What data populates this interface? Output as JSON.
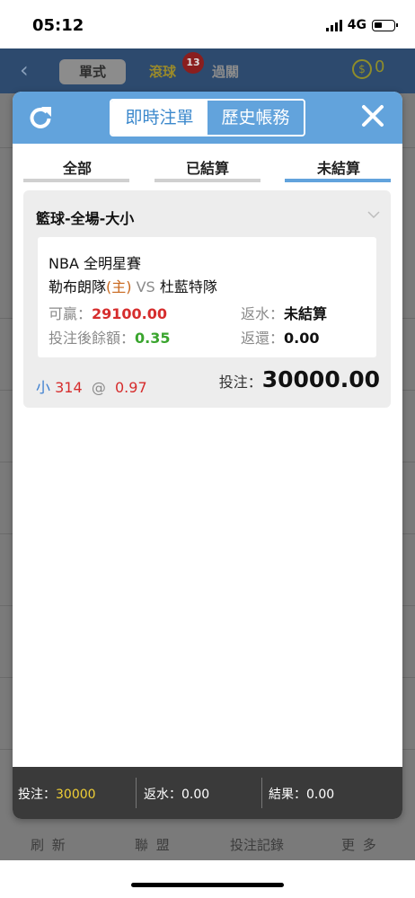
{
  "status_bar": {
    "time": "05:12",
    "network": "4G"
  },
  "background_app": {
    "seg_single": "單式",
    "live": "滾球",
    "live_badge": "13",
    "parlay": "過關",
    "currency_icon": "$",
    "balance": "0",
    "tabbar": [
      "刷 新",
      "聯 盟",
      "投注記錄",
      "更 多"
    ]
  },
  "modal": {
    "header": {
      "tab_instant": "即時注單",
      "tab_history": "歷史帳務"
    },
    "tabs": [
      {
        "label": "全部",
        "active": false
      },
      {
        "label": "已結算",
        "active": false
      },
      {
        "label": "未結算",
        "active": true
      }
    ],
    "bet": {
      "title": "籃球-全場-大小",
      "league": "NBA 全明星賽",
      "home_team": "勒布朗隊",
      "home_tag": "(主)",
      "vs": "VS",
      "away_team": "杜藍特隊",
      "win_label": "可贏：",
      "win_value": "29100.00",
      "balance_label": "投注後餘額：",
      "balance_value": "0.35",
      "rebate_label": "返水：",
      "rebate_value": "未結算",
      "return_label": "返還：",
      "return_value": "0.00",
      "side": "小",
      "line": "314",
      "at": "@",
      "odds": "0.97",
      "stake_label": "投注：",
      "stake_value": "30000.00"
    },
    "footer": {
      "bet_label": "投注：",
      "bet_value": "30000",
      "rebate_label": "返水：",
      "rebate_value": "0.00",
      "result_label": "結果：",
      "result_value": "0.00"
    }
  },
  "colors": {
    "accent": "#62a3dc",
    "win": "#d62d2d",
    "balance": "#3aa52e",
    "footer": "#3a3a3a"
  }
}
